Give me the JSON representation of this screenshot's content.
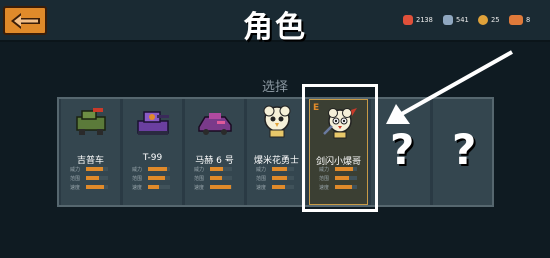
{
  "header": {
    "title": "角色",
    "resources": [
      {
        "icon": "ruby-icon",
        "value": "2138",
        "color": "#e0503a"
      },
      {
        "icon": "material-icon",
        "value": "541",
        "color": "#8fa7c0"
      },
      {
        "icon": "coin-icon",
        "value": "25",
        "color": "#e0a23a"
      },
      {
        "icon": "ticket-icon",
        "value": "8",
        "color": "#e07a3a"
      }
    ]
  },
  "select_label": "选择",
  "stat_labels": [
    "威力",
    "范围",
    "速度"
  ],
  "characters": [
    {
      "name": "吉普车",
      "sprite": "jeep-sprite",
      "stats": [
        0.75,
        0.6,
        0.8
      ],
      "selected": false
    },
    {
      "name": "T-99",
      "sprite": "tank-sprite",
      "stats": [
        0.85,
        0.75,
        0.5
      ],
      "selected": false
    },
    {
      "name": "马赫 6 号",
      "sprite": "mach6-sprite",
      "stats": [
        0.6,
        0.55,
        0.95
      ],
      "selected": false
    },
    {
      "name": "爆米花勇士",
      "sprite": "popcorn-warrior-sprite",
      "stats": [
        0.7,
        0.7,
        0.6
      ],
      "selected": false
    },
    {
      "name": "剑闪小爆哥",
      "sprite": "sword-popcorn-sprite",
      "stats": [
        0.8,
        0.65,
        0.75
      ],
      "selected": true,
      "badge": "E"
    }
  ],
  "locked_slots": [
    "?",
    "?"
  ],
  "colors": {
    "accent": "#e08a2a",
    "highlight": "#ffffff"
  }
}
